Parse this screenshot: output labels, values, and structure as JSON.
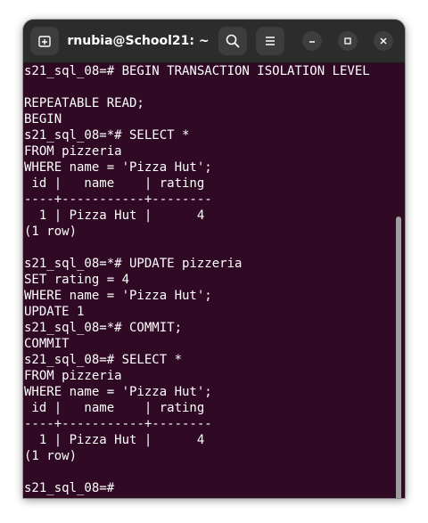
{
  "window": {
    "title": "rnubia@School21: ~",
    "icons": {
      "new_tab": "new-tab-icon",
      "search": "search-icon",
      "menu": "hamburger-menu-icon",
      "minimize": "minimize-icon",
      "maximize": "maximize-icon",
      "close": "close-icon"
    }
  },
  "terminal": {
    "lines": [
      "s21_sql_08=# BEGIN TRANSACTION ISOLATION LEVEL",
      "",
      "REPEATABLE READ;",
      "BEGIN",
      "s21_sql_08=*# SELECT *",
      "FROM pizzeria",
      "WHERE name = 'Pizza Hut';",
      " id |   name    | rating",
      "----+-----------+--------",
      "  1 | Pizza Hut |      4",
      "(1 row)",
      "",
      "s21_sql_08=*# UPDATE pizzeria",
      "SET rating = 4",
      "WHERE name = 'Pizza Hut';",
      "UPDATE 1",
      "s21_sql_08=*# COMMIT;",
      "COMMIT",
      "s21_sql_08=# SELECT *",
      "FROM pizzeria",
      "WHERE name = 'Pizza Hut';",
      " id |   name    | rating",
      "----+-----------+--------",
      "  1 | Pizza Hut |      4",
      "(1 row)",
      "",
      "s21_sql_08=# "
    ]
  },
  "colors": {
    "terminal_background": "#300a24",
    "terminal_text": "#ffffff",
    "titlebar_background": "#2c2c2c",
    "button_background": "#3d3d3d",
    "scrollbar": "#9e9e9e"
  }
}
